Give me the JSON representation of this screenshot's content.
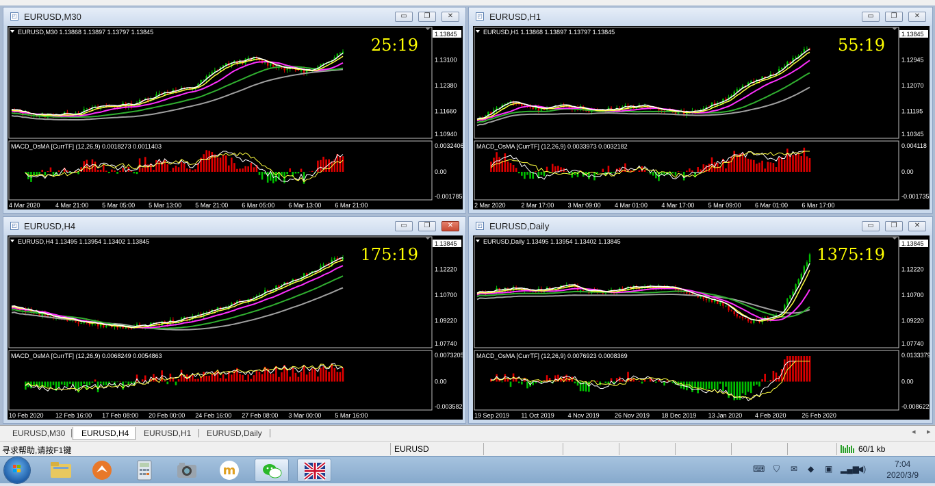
{
  "windows": [
    {
      "title": "EURUSD,M30",
      "header": "EURUSD,M30  1.13868 1.13897 1.13797 1.13845",
      "timer": "25:19",
      "price_labels": [
        "1.13845",
        "1.13100",
        "1.12380",
        "1.11660",
        "1.10940"
      ],
      "macd_header": "MACD_OsMA [CurrTF] (12,26,9) 0.0018273 0.0011403",
      "macd_labels": [
        "0.0032406",
        "0.00",
        "-0.001785"
      ],
      "time_labels": [
        "4 Mar 2020",
        "4 Mar 21:00",
        "5 Mar 05:00",
        "5 Mar 13:00",
        "5 Mar 21:00",
        "6 Mar 05:00",
        "6 Mar 13:00",
        "6 Mar 21:00"
      ]
    },
    {
      "title": "EURUSD,H1",
      "header": "EURUSD,H1  1.13868 1.13897 1.13797 1.13845",
      "timer": "55:19",
      "price_labels": [
        "1.13845",
        "1.12945",
        "1.12070",
        "1.11195",
        "1.10345"
      ],
      "macd_header": "MACD_OsMA [CurrTF] (12,26,9) 0.0033973 0.0032182",
      "macd_labels": [
        "0.004118",
        "0.00",
        "-0.001735"
      ],
      "time_labels": [
        "2 Mar 2020",
        "2 Mar 17:00",
        "3 Mar 09:00",
        "4 Mar 01:00",
        "4 Mar 17:00",
        "5 Mar 09:00",
        "6 Mar 01:00",
        "6 Mar 17:00"
      ]
    },
    {
      "title": "EURUSD,H4",
      "header": "EURUSD,H4  1.13495 1.13954 1.13402 1.13845",
      "timer": "175:19",
      "price_labels": [
        "1.13845",
        "1.12220",
        "1.10700",
        "1.09220",
        "1.07740"
      ],
      "macd_header": "MACD_OsMA [CurrTF] (12,26,9) 0.0068249 0.0054863",
      "macd_labels": [
        "0.0073205",
        "0.00",
        "-0.003582"
      ],
      "time_labels": [
        "10 Feb 2020",
        "12 Feb 16:00",
        "17 Feb 08:00",
        "20 Feb 00:00",
        "24 Feb 16:00",
        "27 Feb 08:00",
        "3 Mar 00:00",
        "5 Mar 16:00"
      ]
    },
    {
      "title": "EURUSD,Daily",
      "header": "EURUSD,Daily  1.13495 1.13954 1.13402 1.13845",
      "timer": "1375:19",
      "price_labels": [
        "1.13845",
        "1.12220",
        "1.10700",
        "1.09220",
        "1.07740"
      ],
      "macd_header": "MACD_OsMA [CurrTF] (12,26,9) 0.0076923 0.0008369",
      "macd_labels": [
        "0.0133379",
        "0.00",
        "-0.008622"
      ],
      "time_labels": [
        "19 Sep 2019",
        "11 Oct 2019",
        "4 Nov 2019",
        "26 Nov 2019",
        "18 Dec 2019",
        "13 Jan 2020",
        "4 Feb 2020",
        "26 Feb 2020"
      ]
    }
  ],
  "window_buttons": {
    "minimize": "▭",
    "restore": "❐",
    "close": "✕"
  },
  "tabs": [
    "EURUSD,M30",
    "EURUSD,H4",
    "EURUSD,H1",
    "EURUSD,Daily"
  ],
  "active_tab": "EURUSD,H4",
  "statusbar": {
    "help": "寻求帮助,请按F1键",
    "symbol": "EURUSD",
    "traffic": "60/1 kb"
  },
  "clock": {
    "time": "7:04",
    "date": "2020/3/9"
  },
  "taskbar_icons": [
    "folder-icon",
    "app-orange-icon",
    "calculator-icon",
    "camera-icon",
    "m-app-icon",
    "wechat-icon",
    "uk-flag-icon"
  ],
  "colors": {
    "chart_bg": "#000000",
    "bull": "#00c000",
    "bear": "#e00000",
    "ma_fast": "#ffffff",
    "ma_yellow": "#ffff40",
    "ma_magenta": "#ff30ff",
    "ma_green": "#30b030",
    "ma_gray": "#a0a0a0",
    "timer": "#ffff00"
  }
}
